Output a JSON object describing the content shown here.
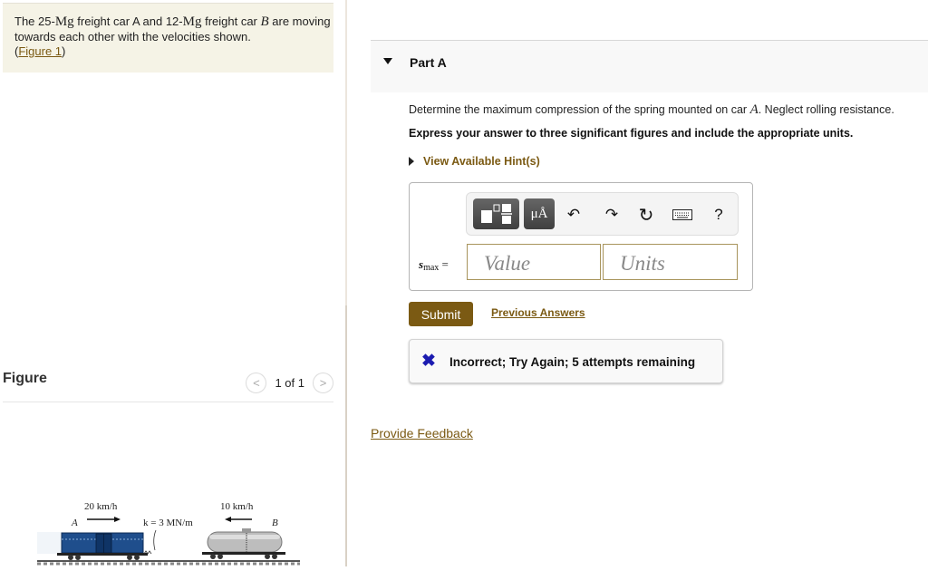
{
  "intro": {
    "t1": "The 25-",
    "mass_unit_a": "Mg",
    "t2": " freight car A and 12-",
    "mass_unit_b": "Mg",
    "t3": " freight car ",
    "car_b": "B",
    "t4": " are moving towards each other with the velocities shown.",
    "paren_open": "(",
    "figure_link": "Figure 1",
    "paren_close": ")"
  },
  "figure_panel": {
    "title": "Figure",
    "pager_text": "1 of 1",
    "prev_icon": "chevron-left",
    "next_icon": "chevron-right",
    "prev_glyph": "<",
    "next_glyph": ">",
    "diagram": {
      "car_a_label": "A",
      "car_b_label": "B",
      "velocity_a": "20 km/h",
      "velocity_b": "10 km/h",
      "spring_label": "k = 3 MN/m",
      "car_a_color": "#1f4e8c",
      "car_b_color": "#bdbdbd"
    }
  },
  "part_a": {
    "title": "Part A",
    "question_pre": "Determine the maximum compression of the spring mounted on car ",
    "question_var": "A",
    "question_post": ". Neglect rolling resistance.",
    "instruction": "Express your answer to three significant figures and include the appropriate units.",
    "hints_label": "View Available Hint(s)",
    "toolbar": {
      "templates_icon": "templates-icon",
      "units_icon": "μÅ",
      "undo_icon": "↶",
      "redo_icon": "↷",
      "reset_icon": "↻",
      "keyboard_icon": "keyboard-icon",
      "help_icon": "?"
    },
    "answer_label_var": "s",
    "answer_label_sub": "max",
    "answer_label_eq": " =",
    "value_placeholder": "Value",
    "units_placeholder": "Units",
    "submit_label": "Submit",
    "previous_answers_label": "Previous Answers",
    "feedback_icon": "✖",
    "feedback_text": "Incorrect; Try Again; 5 attempts remaining"
  },
  "provide_feedback_label": "Provide Feedback",
  "colors": {
    "accent": "#7b5a13",
    "intro_bg": "#f5f3e6",
    "incorrect_icon": "#1b1bb0"
  }
}
